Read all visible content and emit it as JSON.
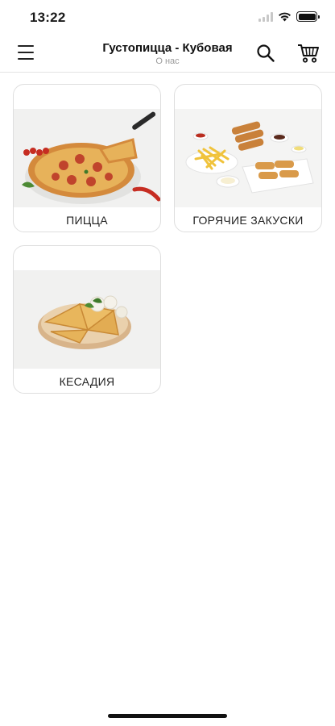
{
  "status_bar": {
    "time": "13:22",
    "battery_level": 1.0
  },
  "header": {
    "title": "Густопицца - Кубовая",
    "subtitle": "О нас",
    "icons": [
      "menu-icon",
      "search-icon",
      "cart-icon"
    ]
  },
  "categories": [
    {
      "label": "ПИЦЦА",
      "image": "pizza-photo"
    },
    {
      "label": "ГОРЯЧИЕ ЗАКУСКИ",
      "image": "hot-snacks-photo"
    },
    {
      "label": "КЕСАДИЯ",
      "image": "quesadilla-photo"
    }
  ],
  "colors": {
    "background": "#ffffff",
    "card_border": "#dedede",
    "subtitle": "#9a9a9a",
    "text": "#1a1a1a"
  }
}
